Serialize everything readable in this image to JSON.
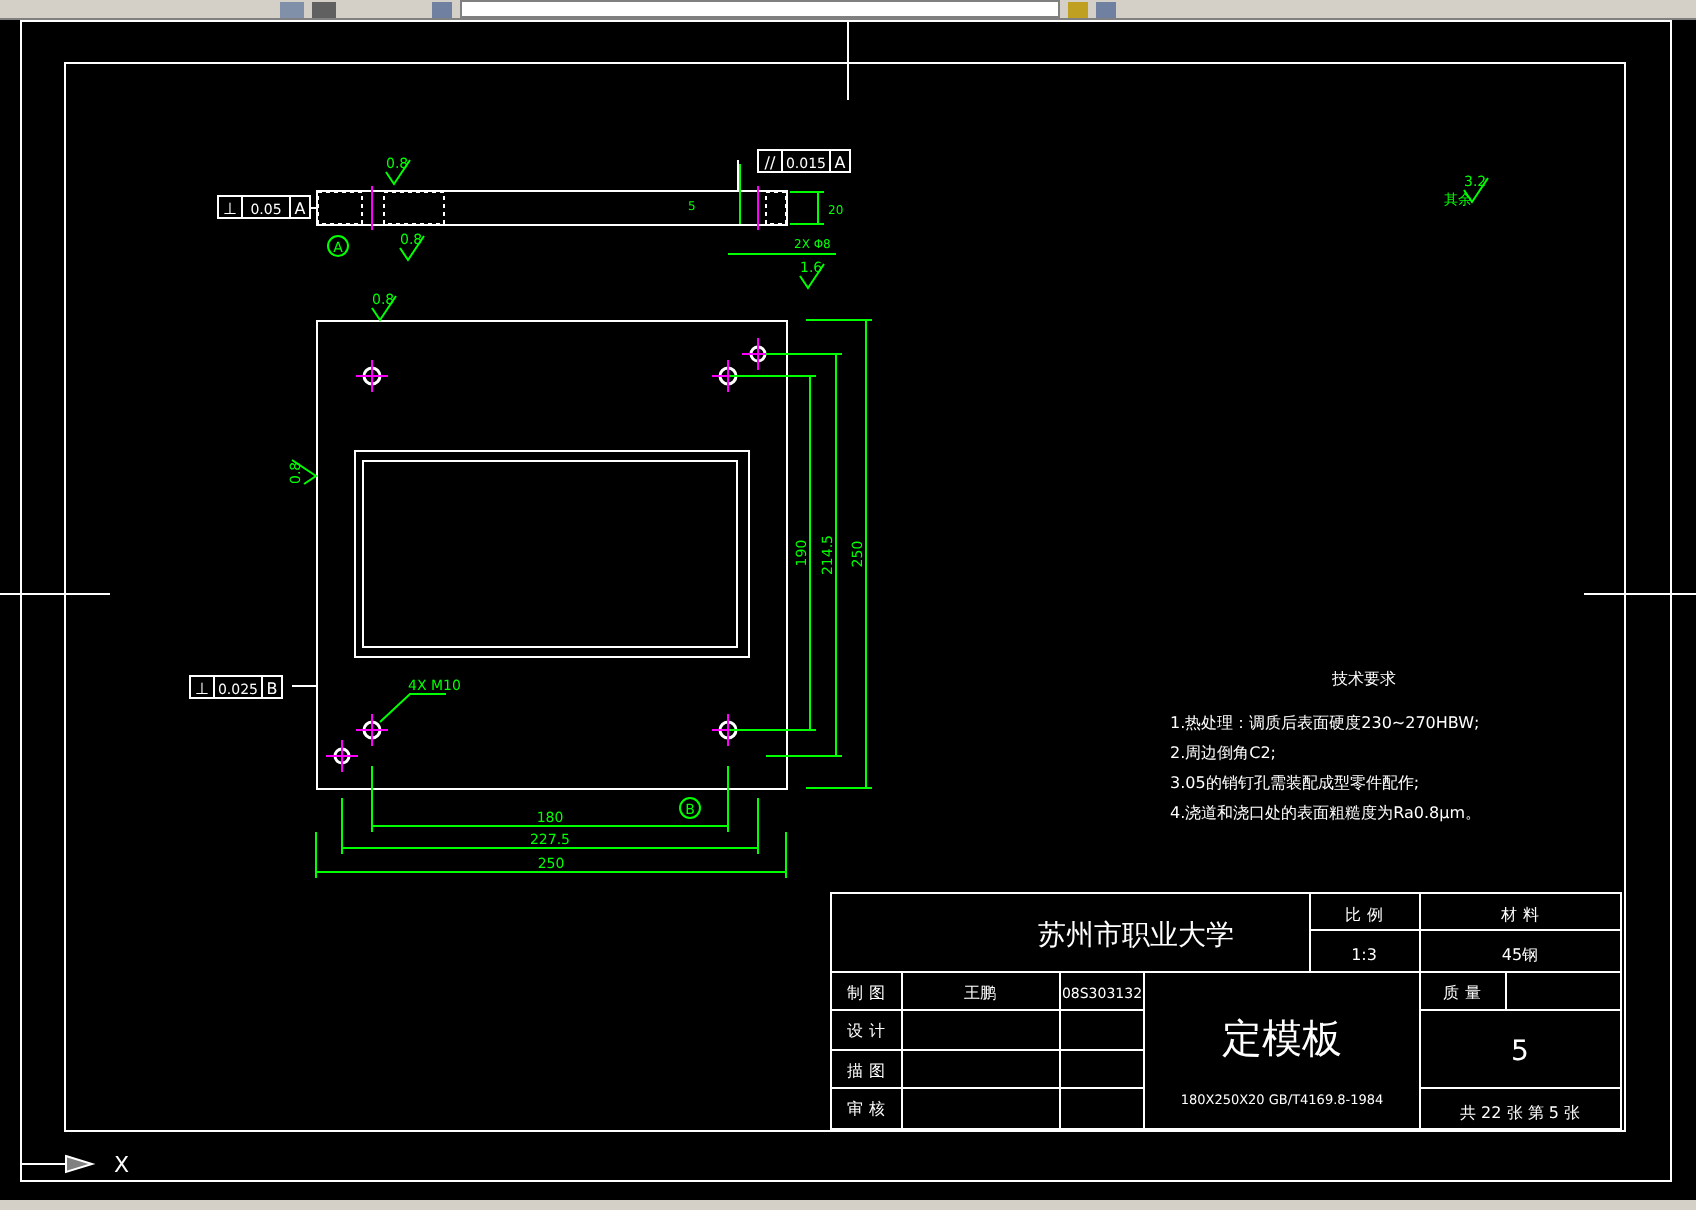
{
  "drawing": {
    "top_view": {
      "tolerance": {
        "symbol": "⊥",
        "value": "0.05",
        "datum": "A"
      },
      "parallel_tolerance": {
        "symbol": "//",
        "value": "0.015",
        "datum": "A"
      },
      "datum": "A",
      "roughness": [
        "0.8",
        "0.8",
        "1.6"
      ],
      "dims": [
        "5",
        "20"
      ],
      "hole_note": "2X Φ8"
    },
    "front_view": {
      "roughness": [
        "0.8",
        "0.8"
      ],
      "tolerance": {
        "symbol": "⊥",
        "value": "0.025",
        "datum": "B"
      },
      "datum": "B",
      "hole_note": "4X M10",
      "horizontal_dims": [
        "180",
        "227.5",
        "250"
      ],
      "vertical_dims": [
        "190",
        "214.5",
        "250"
      ]
    },
    "ucs_axis_label": "X",
    "surface_note": {
      "label": "其余",
      "value": "3.2"
    },
    "requirements": {
      "title": "技术要求",
      "items": [
        "1.热处理：调质后表面硬度230~270HBW;",
        "2.周边倒角C2;",
        "3.05的销钉孔需装配成型零件配作;",
        "4.浇道和浇口处的表面粗糙度为Ra0.8μm。"
      ]
    },
    "title_block": {
      "school": "苏州市职业大学",
      "scale_label": "比 例",
      "scale": "1:3",
      "material_label": "材 料",
      "material": "45钢",
      "part_name": "定模板",
      "part_spec": "180X250X20 GB/T4169.8-1984",
      "mass_label": "质 量",
      "quantity": "5",
      "sheet": "共 22 张  第 5 张",
      "rows": [
        {
          "label": "制 图",
          "name": "王鹏",
          "code": "08S303132"
        },
        {
          "label": "设 计"
        },
        {
          "label": "描 图"
        },
        {
          "label": "审 核"
        }
      ]
    }
  }
}
